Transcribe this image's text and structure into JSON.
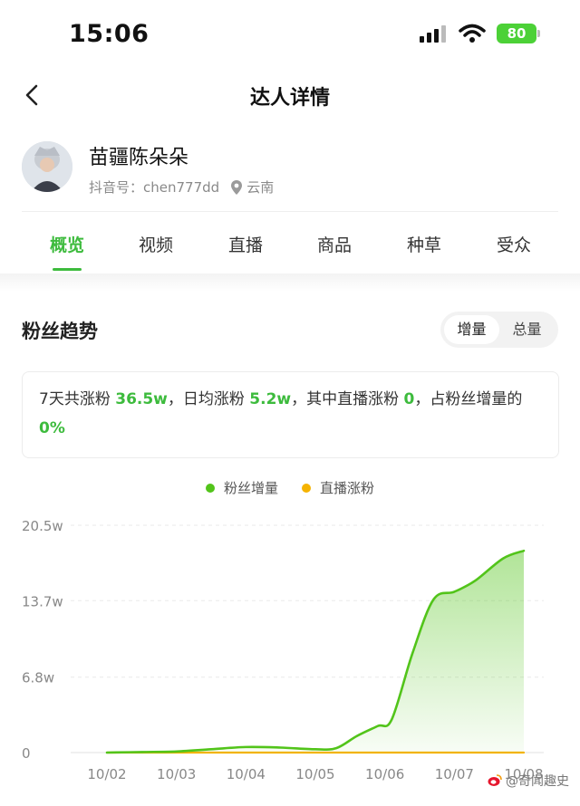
{
  "status_bar": {
    "time": "15:06",
    "battery": "80"
  },
  "nav": {
    "title": "达人详情"
  },
  "profile": {
    "name": "苗疆陈朵朵",
    "douyin_label": "抖音号：",
    "douyin_id": "chen777dd",
    "location": "云南"
  },
  "tabs": [
    {
      "label": "概览",
      "active": true
    },
    {
      "label": "视频"
    },
    {
      "label": "直播"
    },
    {
      "label": "商品"
    },
    {
      "label": "种草"
    },
    {
      "label": "受众"
    }
  ],
  "section": {
    "title": "粉丝趋势",
    "toggle": [
      "增量",
      "总量"
    ]
  },
  "summary": {
    "p1": "7天共涨粉 ",
    "v1": "36.5w",
    "p2": "，日均涨粉 ",
    "v2": "5.2w",
    "p3": "，其中直播涨粉 ",
    "v3": "0",
    "p4": "，占粉丝增量的 ",
    "v4": "0%"
  },
  "colors": {
    "accent": "#3dbb3d",
    "line_green": "#52c41a",
    "line_orange": "#f5b301"
  },
  "chart_data": {
    "type": "line",
    "x": [
      "10/02",
      "10/03",
      "10/04",
      "10/05",
      "10/06",
      "10/07",
      "10/08"
    ],
    "ytick_labels": [
      "0",
      "6.8w",
      "13.7w",
      "20.5w"
    ],
    "ytick_values": [
      0,
      6.8,
      13.7,
      20.5
    ],
    "ylim": [
      0,
      20.5
    ],
    "unit": "w",
    "legend_position": "top-center",
    "series": [
      {
        "name": "粉丝增量",
        "color": "#52c41a",
        "fill": true,
        "points": [
          [
            0,
            0.0
          ],
          [
            0.5,
            0.05
          ],
          [
            1,
            0.1
          ],
          [
            1.5,
            0.3
          ],
          [
            2,
            0.5
          ],
          [
            2.5,
            0.45
          ],
          [
            3,
            0.3
          ],
          [
            3.3,
            0.4
          ],
          [
            3.6,
            1.5
          ],
          [
            3.9,
            2.4
          ],
          [
            4.1,
            3.0
          ],
          [
            4.4,
            9.0
          ],
          [
            4.7,
            13.8
          ],
          [
            5,
            14.5
          ],
          [
            5.3,
            15.5
          ],
          [
            5.7,
            17.5
          ],
          [
            6,
            18.2
          ]
        ]
      },
      {
        "name": "直播涨粉",
        "color": "#f5b301",
        "fill": false,
        "points": [
          [
            0,
            0
          ],
          [
            1,
            0
          ],
          [
            2,
            0
          ],
          [
            3,
            0
          ],
          [
            4,
            0
          ],
          [
            5,
            0
          ],
          [
            6,
            0
          ]
        ]
      }
    ]
  },
  "watermark": "@奇闻趣史"
}
